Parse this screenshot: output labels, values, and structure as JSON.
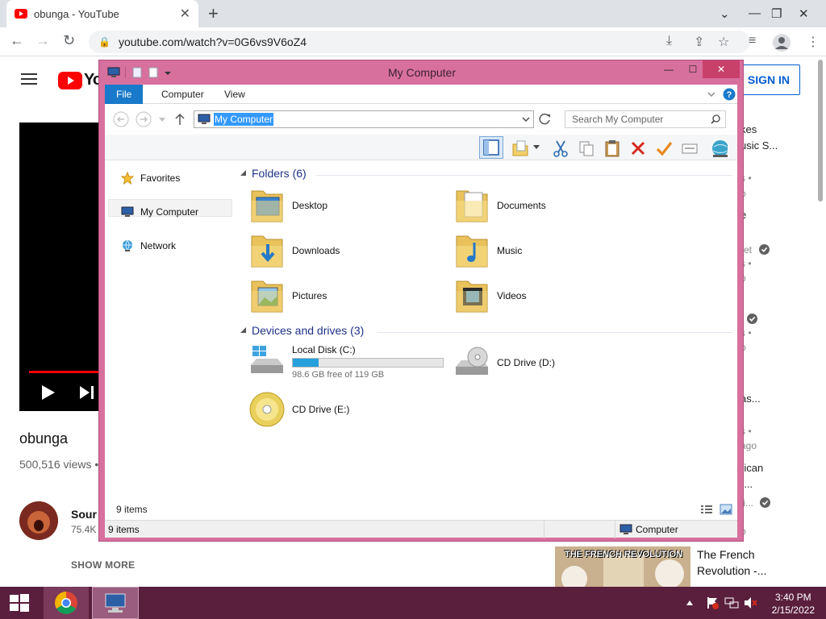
{
  "browser": {
    "tab_title": "obunga - YouTube",
    "url": "youtube.com/watch?v=0G6vs9V6oZ4"
  },
  "youtube": {
    "logo_text": "Yo",
    "sign_in": "SIGN IN",
    "video_title": "obunga",
    "views": "500,516 views •",
    "channel_name": "Sour",
    "subscribers": "75.4K",
    "show_more": "SHOW MORE",
    "sidebar_fragments": [
      {
        "text": "kes",
        "muted": false
      },
      {
        "text": "usic S...",
        "muted": false
      },
      {
        "text": "s •",
        "muted": true
      },
      {
        "text": "o",
        "muted": true
      },
      {
        "text": "e",
        "muted": false
      },
      {
        "text": "ret",
        "muted": true
      },
      {
        "text": "s •",
        "muted": true
      },
      {
        "text": "o",
        "muted": true
      },
      {
        "text": "s •",
        "muted": true
      },
      {
        "text": "o",
        "muted": true
      },
      {
        "text": "as...",
        "muted": false
      },
      {
        "text": "s •",
        "muted": true
      },
      {
        "text": "ago",
        "muted": true
      },
      {
        "text": "rican",
        "muted": false
      },
      {
        "text": "-...",
        "muted": false
      },
      {
        "text": "fi...",
        "muted": true
      },
      {
        "text": "o",
        "muted": true
      }
    ],
    "related_thumb_caption": "THE FRENCH REVOLUTION",
    "related_title_line1": "The French",
    "related_title_line2": "Revolution -..."
  },
  "explorer": {
    "title": "My Computer",
    "ribbon_tabs": [
      "File",
      "Computer",
      "View"
    ],
    "address": "My Computer",
    "search_placeholder": "Search My Computer",
    "nav": {
      "favorites": "Favorites",
      "my_computer": "My Computer",
      "network": "Network"
    },
    "folders_header": "Folders (6)",
    "folders": [
      {
        "name": "Desktop",
        "icon": "desktop-folder-icon"
      },
      {
        "name": "Documents",
        "icon": "documents-folder-icon"
      },
      {
        "name": "Downloads",
        "icon": "downloads-folder-icon"
      },
      {
        "name": "Music",
        "icon": "music-folder-icon"
      },
      {
        "name": "Pictures",
        "icon": "pictures-folder-icon"
      },
      {
        "name": "Videos",
        "icon": "videos-folder-icon"
      }
    ],
    "drives_header": "Devices and drives (3)",
    "drives": {
      "c": {
        "name": "Local Disk (C:)",
        "free": "98.6 GB free of 119 GB",
        "used_fraction": 0.171
      },
      "d": {
        "name": "CD Drive (D:)"
      },
      "e": {
        "name": "CD Drive (E:)"
      }
    },
    "item_count": "9 items",
    "status_count": "9 items",
    "status_location": "Computer"
  },
  "taskbar": {
    "time": "3:40 PM",
    "date": "2/15/2022"
  },
  "colors": {
    "window_frame": "#d8709e",
    "taskbar": "#5a1f3d",
    "ribbon_file": "#1979ca",
    "youtube_red": "#ff0000",
    "drive_bar": "#26a0da"
  }
}
